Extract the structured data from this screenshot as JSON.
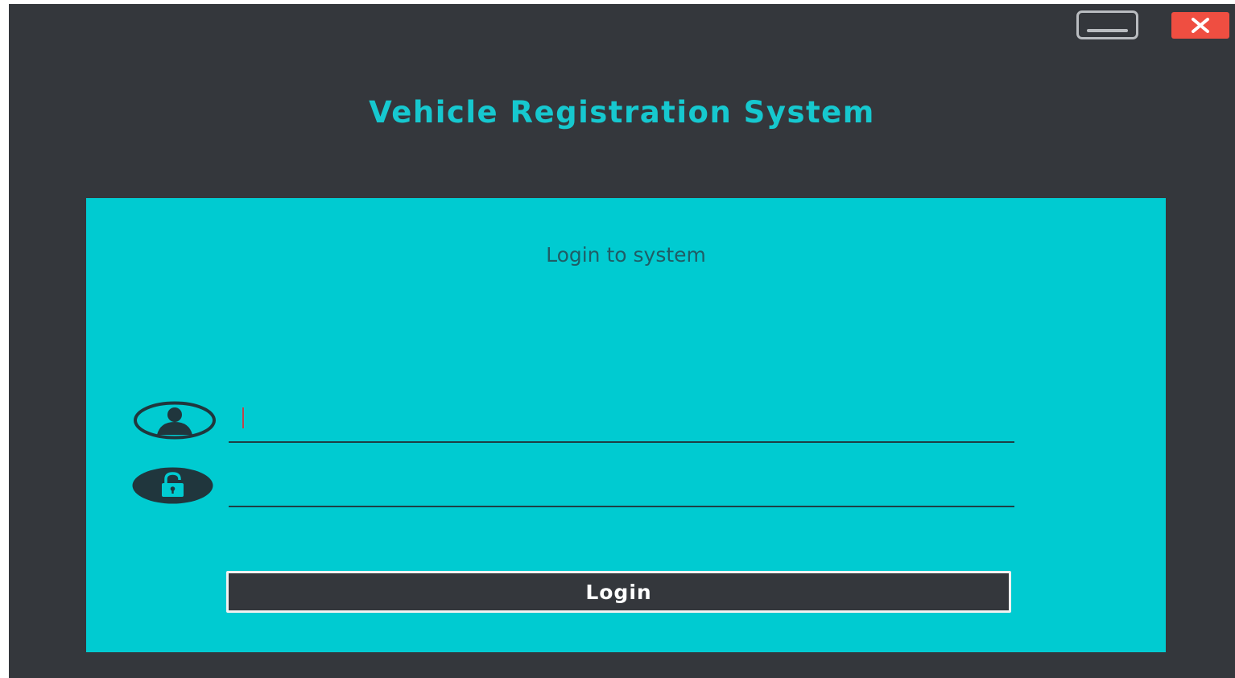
{
  "window": {
    "minimize_icon": "minimize-icon",
    "close_icon": "close-icon",
    "close_color": "#ef4e41"
  },
  "header": {
    "title": "Vehicle Registration System",
    "title_color": "#16c8cf",
    "background": "#34373c"
  },
  "login_panel": {
    "heading": "Login to system",
    "background": "#00cbd1",
    "username_field": {
      "icon": "user-icon",
      "value": "",
      "placeholder": ""
    },
    "password_field": {
      "icon": "lock-icon",
      "value": "",
      "placeholder": ""
    },
    "login_button": {
      "label": "Login",
      "background": "#34373c"
    }
  }
}
